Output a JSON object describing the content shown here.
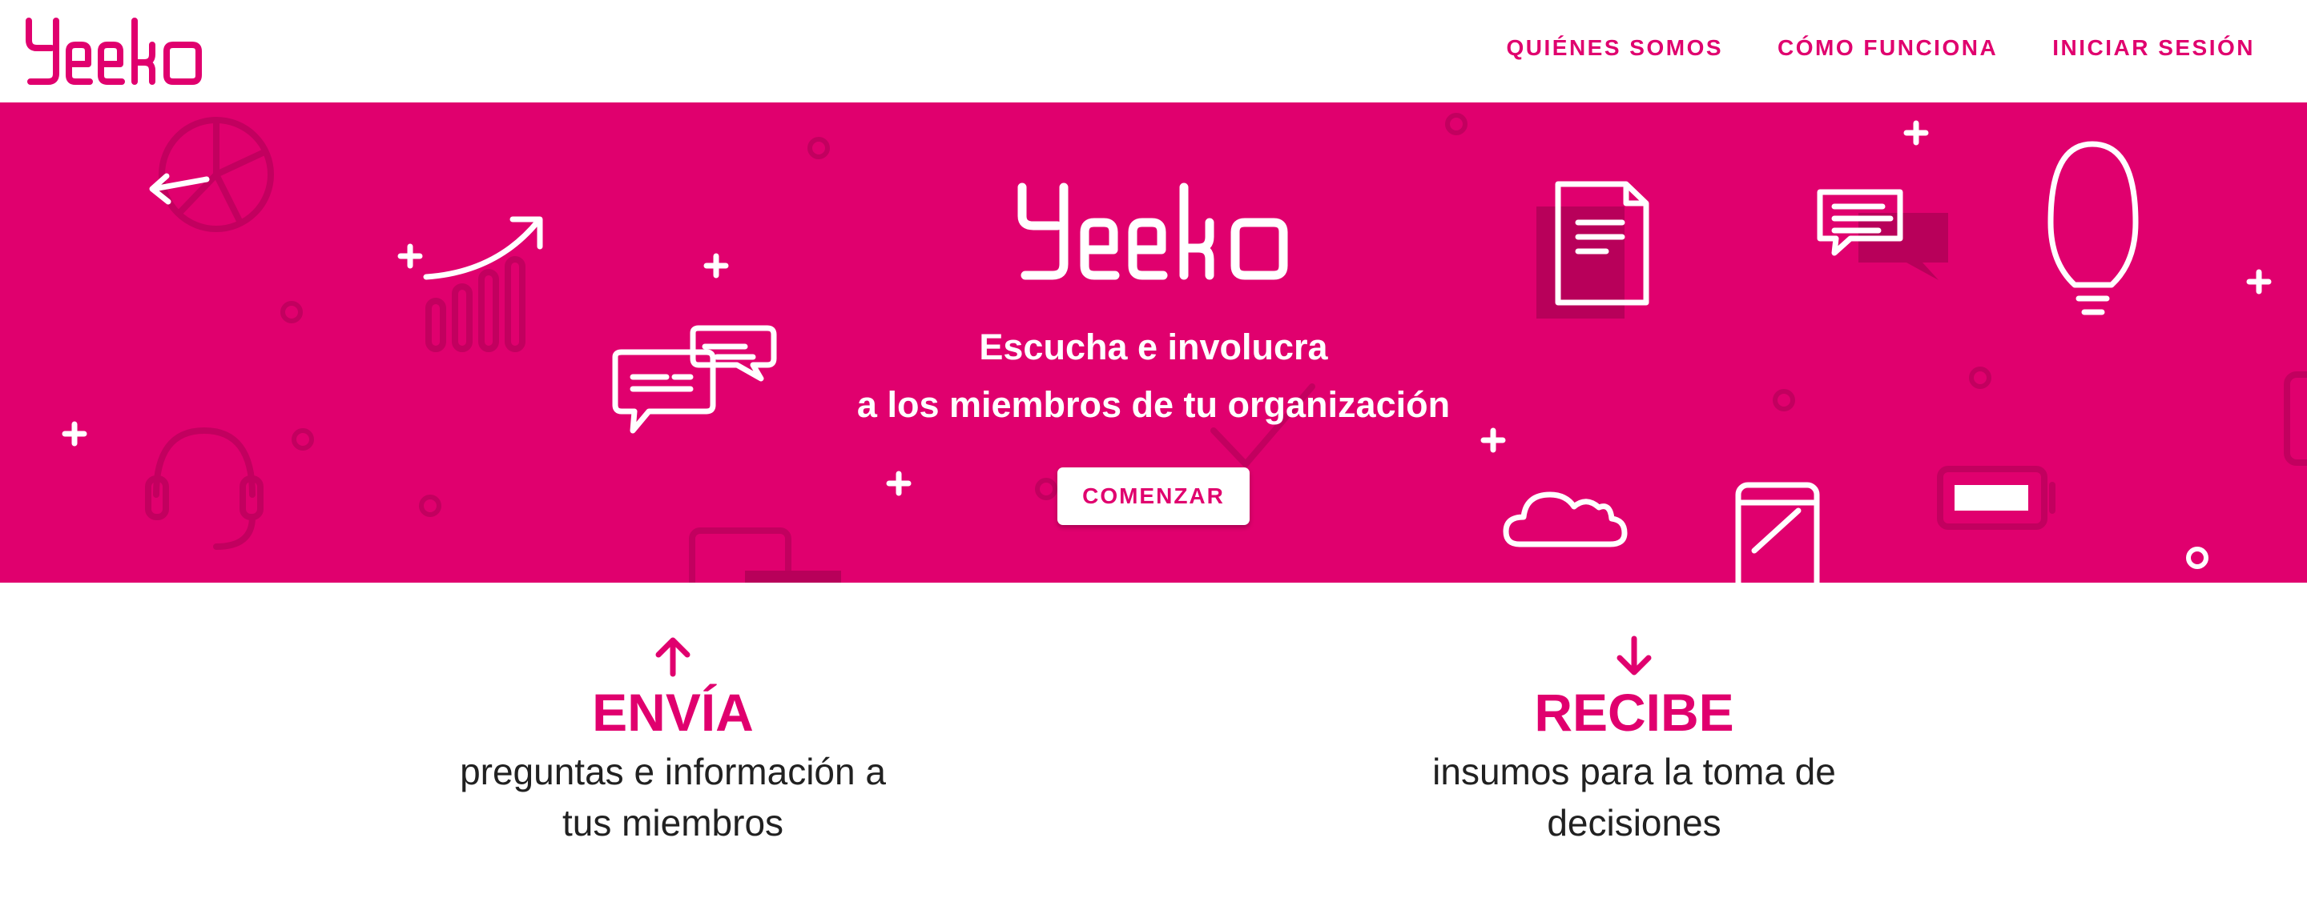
{
  "brand": {
    "name": "Yeeko",
    "color": "#e0006e"
  },
  "nav": {
    "items": [
      {
        "label": "QUIÉNES SOMOS"
      },
      {
        "label": "CÓMO FUNCIONA"
      },
      {
        "label": "INICIAR SESIÓN"
      }
    ]
  },
  "hero": {
    "logo_text": "Yeeko",
    "line1": "Escucha e involucra",
    "line2": "a los miembros de tu organización",
    "cta_label": "COMENZAR",
    "background_icons": [
      "pie-chart-icon",
      "trend-chart-icon",
      "chat-icon",
      "headset-icon",
      "checkmark-icon",
      "document-icon",
      "cloud-icon",
      "phone-icon",
      "lightbulb-icon",
      "battery-icon",
      "plus-icon",
      "ring-icon"
    ]
  },
  "features": [
    {
      "icon": "arrow-up-icon",
      "title": "ENVÍA",
      "desc_line1": "preguntas e información a",
      "desc_line2": "tus miembros"
    },
    {
      "icon": "arrow-down-icon",
      "title": "RECIBE",
      "desc_line1": "insumos para la toma de",
      "desc_line2": "decisiones"
    }
  ]
}
